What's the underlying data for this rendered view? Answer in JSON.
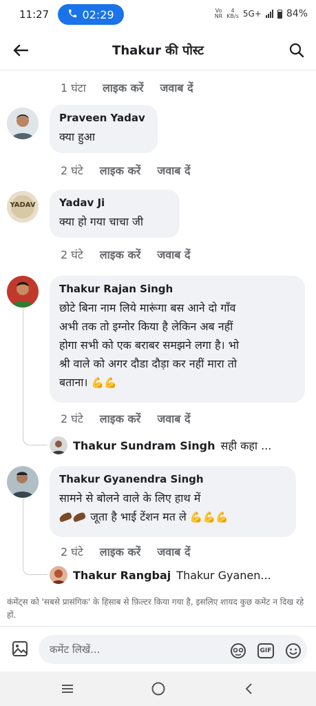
{
  "status_bar": {
    "time": "11:27",
    "call_timer": "02:29",
    "network": "5G+",
    "volte_label": "Vo\nNR",
    "speed_value": "4",
    "speed_unit": "KB/s",
    "battery": "84%"
  },
  "header": {
    "title": "Thakur की पोस्ट"
  },
  "comments": [
    {
      "meta_time": "1 घंटा",
      "like_label": "लाइक करें",
      "reply_label": "जवाब दें"
    },
    {
      "author": "Praveen Yadav",
      "text": "क्या हुआ",
      "meta_time": "2 घंटे",
      "like_label": "लाइक करें",
      "reply_label": "जवाब दें"
    },
    {
      "author": "Yadav Ji",
      "avatar_text": "YADAV",
      "text": "क्या हो गया चाचा जी",
      "meta_time": "2 घंटे",
      "like_label": "लाइक करें",
      "reply_label": "जवाब दें"
    },
    {
      "author": "Thakur Rajan Singh",
      "text_lines": [
        "छोटे बिना नाम लिये मारूंगा बस आने दो गाँव",
        "अभी तक तो इग्नोर किया है लेकिन अब नहीं",
        "होगा सभी को एक बराबर समझने लगा है। भो",
        "श्री वाले को अगर दौडा दौड़ा कर नहीं मारा तो",
        "बताना।"
      ],
      "meta_time": "2 घंटे",
      "like_label": "लाइक करें",
      "reply_label": "जवाब दें",
      "reply_preview": {
        "author": "Thakur Sundram Singh",
        "text": "सही कहा ..."
      }
    },
    {
      "author": "Thakur Gyanendra Singh",
      "text_line1": "सामने से बोलने वाले के लिए हाथ में",
      "text_line2": "जूता है भाई टेंशन मत ले",
      "meta_time": "2 घंटे",
      "like_label": "लाइक करें",
      "reply_label": "जवाब दें",
      "reply_preview": {
        "author": "Thakur Rangbaj",
        "text": "Thakur Gyanen..."
      }
    }
  ],
  "filter_note": "कंमेंट्स को 'सबसे प्रासंगिक' के हिसाब से फ़िल्टर किया गया है, इसलिए शायद कुछ कमेंट न दिख रहे हों.",
  "composer": {
    "placeholder": "कमेंट लिखें...",
    "gif_label": "GIF"
  },
  "colors": {
    "accent": "#1a73e8",
    "bubble": "#f0f2f5",
    "meta": "#65676b"
  }
}
